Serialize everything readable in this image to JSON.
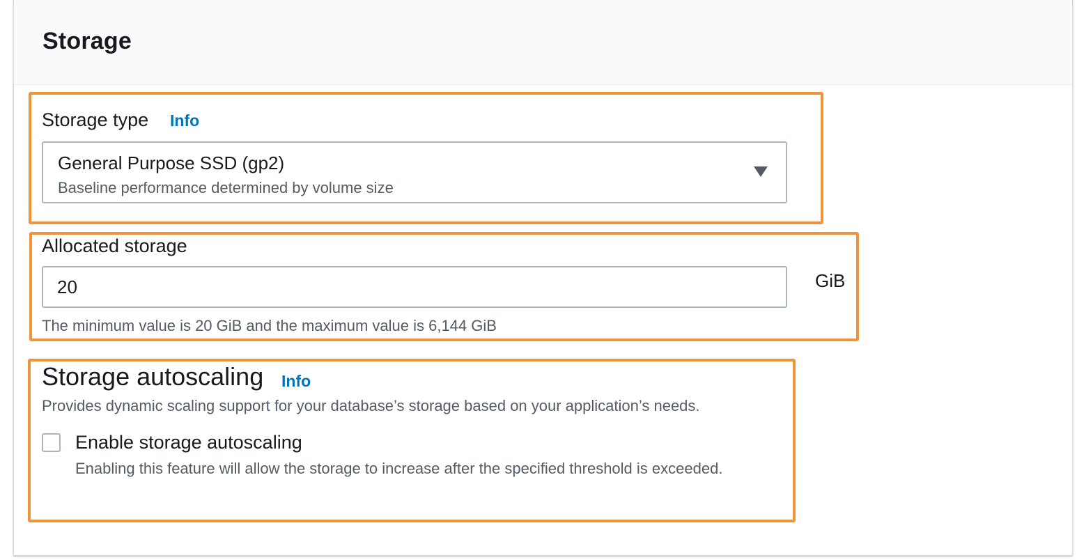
{
  "panel": {
    "title": "Storage"
  },
  "storage_type": {
    "label": "Storage type",
    "info_link": "Info",
    "selected_value": "General Purpose SSD (gp2)",
    "selected_description": "Baseline performance determined by volume size"
  },
  "allocated_storage": {
    "label": "Allocated storage",
    "value": "20",
    "unit": "GiB",
    "constraint_text": "The minimum value is 20 GiB and the maximum value is 6,144 GiB"
  },
  "storage_autoscaling": {
    "title": "Storage autoscaling",
    "info_link": "Info",
    "description": "Provides dynamic scaling support for your database’s storage based on your application’s needs.",
    "checkbox_label": "Enable storage autoscaling",
    "checkbox_checked": false,
    "checkbox_description": "Enabling this feature will allow the storage to increase after the specified threshold is exceeded."
  },
  "colors": {
    "highlight": "#f0943c",
    "link": "#0073bb",
    "border": "#aab7b8",
    "secondary_text": "#545b64"
  },
  "icons": {
    "dropdown": "caret-down-icon"
  }
}
